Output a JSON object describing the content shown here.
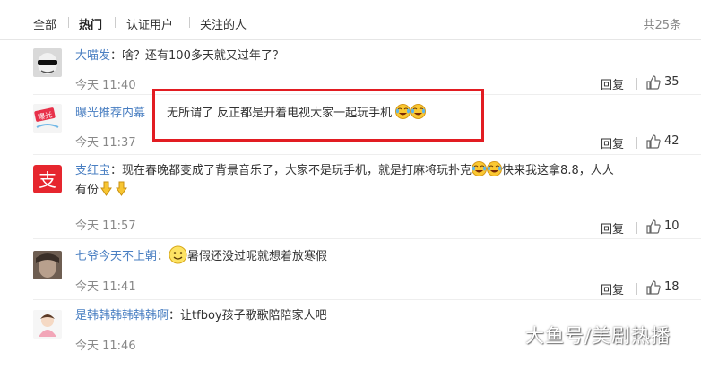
{
  "tabs": {
    "all": "全部",
    "hot": "热门",
    "verified": "认证用户",
    "followed": "关注的人",
    "total": "共25条"
  },
  "actions": {
    "reply": "回复"
  },
  "comments": [
    {
      "user": "大喵发",
      "separator": "：",
      "text": "啥？还有100多天就又过年了？",
      "time": "今天 11:40",
      "likes": "35"
    },
    {
      "user": "曝光推荐内幕",
      "separator": "",
      "text": "无所谓了 反正都是开着电视大家一起玩手机",
      "time": "今天 11:37",
      "likes": "42"
    },
    {
      "user": "支红宝",
      "separator": "：",
      "text": "现在春晚都变成了背景音乐了，大家不是玩手机，就是打麻将玩扑克",
      "text2": "快来我这拿8.8，人人",
      "text3": "有份",
      "time": "今天 11:57",
      "likes": "10"
    },
    {
      "user": "七爷今天不上朝",
      "separator": "：",
      "text": "暑假还没过呢就想着放寒假",
      "time": "今天 11:41",
      "likes": "18"
    },
    {
      "user": "是韩韩韩韩韩韩啊",
      "separator": "：",
      "text": "让tfboy孩子歌歌陪陪家人吧",
      "time": "今天 11:46",
      "likes": ""
    }
  ],
  "avatars": {
    "alipay_logo": "支",
    "exposure_logo": "曝光"
  },
  "watermark": "大鱼号/美剧热播",
  "colors": {
    "username": "#4a7fc2",
    "highlight": "#e21c22",
    "alipay": "#e6262e"
  }
}
